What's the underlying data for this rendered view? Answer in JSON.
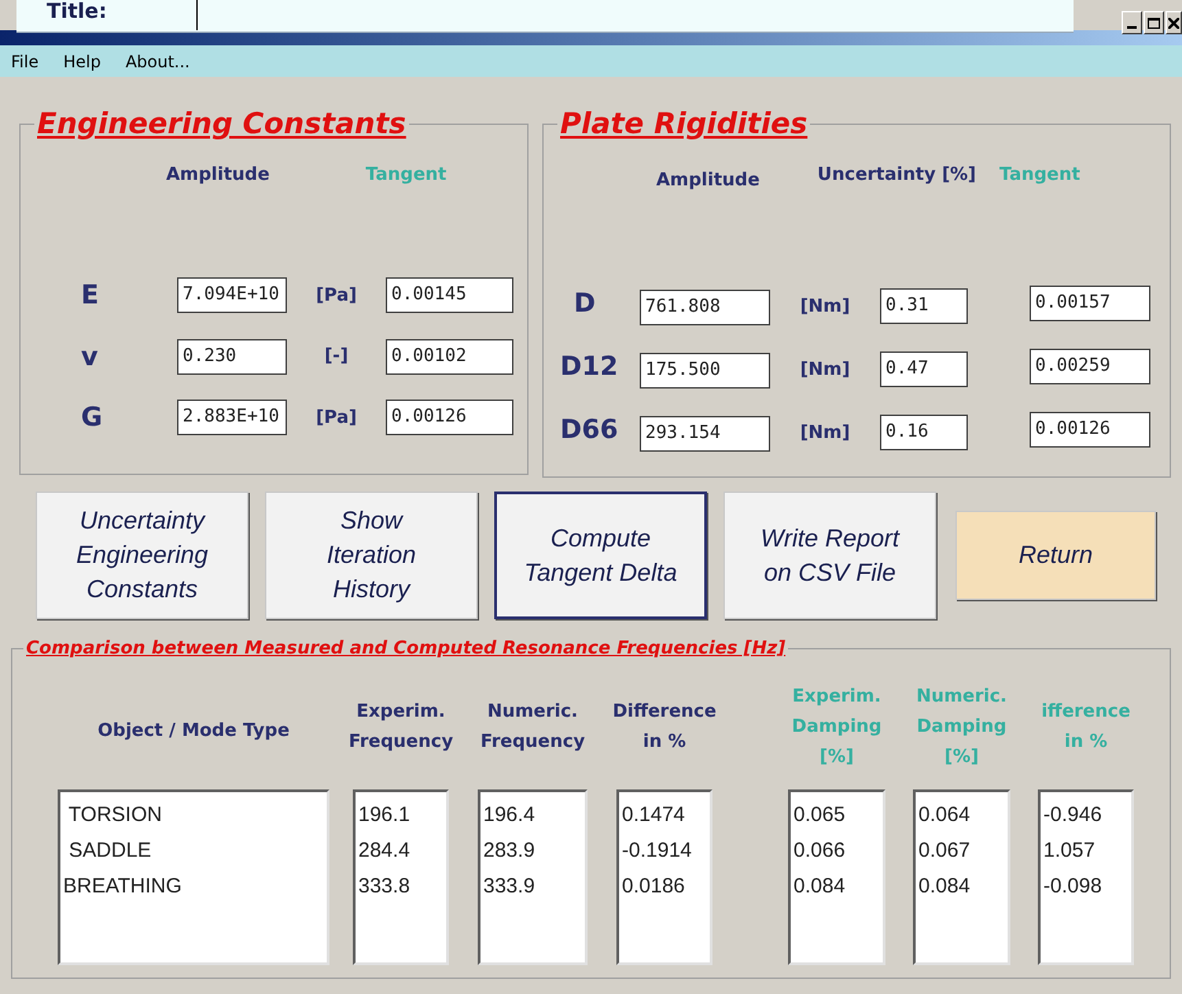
{
  "title_field": {
    "label": "Title:"
  },
  "menu": [
    "File",
    "Help",
    "About..."
  ],
  "engineering_constants": {
    "title": "Engineering Constants",
    "headers": [
      {
        "label": "Amplitude",
        "kind": "amplitude"
      },
      {
        "label": "Tangent",
        "kind": "tangent"
      }
    ],
    "rows": [
      {
        "symbol": "E",
        "amplitude": "7.094E+10",
        "unit": "[Pa]",
        "tangent": "0.00145"
      },
      {
        "symbol": "v",
        "amplitude": "0.230",
        "unit": "[-]",
        "tangent": "0.00102"
      },
      {
        "symbol": "G",
        "amplitude": "2.883E+10",
        "unit": "[Pa]",
        "tangent": "0.00126"
      }
    ]
  },
  "plate_rigidities": {
    "title": "Plate Rigidities",
    "headers": [
      {
        "label": "Amplitude",
        "kind": "amplitude"
      },
      {
        "label": "Uncertainty [%]",
        "kind": "amplitude"
      },
      {
        "label": "Tangent",
        "kind": "tangent"
      }
    ],
    "rows": [
      {
        "symbol": "D",
        "amplitude": "761.808",
        "unit": "[Nm]",
        "uncertainty": "0.31",
        "tangent": "0.00157"
      },
      {
        "symbol": "D12",
        "amplitude": "175.500",
        "unit": "[Nm]",
        "uncertainty": "0.47",
        "tangent": "0.00259"
      },
      {
        "symbol": "D66",
        "amplitude": "293.154",
        "unit": "[Nm]",
        "uncertainty": "0.16",
        "tangent": "0.00126"
      }
    ]
  },
  "buttons": [
    {
      "label": "Uncertainty\nEngineering\nConstants",
      "kind": "standard",
      "focused": false
    },
    {
      "label": "Show\nIteration\nHistory",
      "kind": "standard",
      "focused": false
    },
    {
      "label": "Compute\nTangent Delta",
      "kind": "standard",
      "focused": true
    },
    {
      "label": "Write Report\non CSV File",
      "kind": "standard",
      "focused": false
    },
    {
      "label": "Return",
      "kind": "return",
      "focused": false
    }
  ],
  "comparison": {
    "title": "Comparison between Measured and Computed Resonance Frequencies [Hz]",
    "columns": [
      {
        "label": "Object / Mode Type",
        "kind": "frequency",
        "values": [
          " TORSION",
          " SADDLE",
          "BREATHING"
        ]
      },
      {
        "label": "Experim.\nFrequency",
        "kind": "frequency",
        "values": [
          "196.1",
          "284.4",
          "333.8"
        ]
      },
      {
        "label": "Numeric.\nFrequency",
        "kind": "frequency",
        "values": [
          "196.4",
          "283.9",
          "333.9"
        ]
      },
      {
        "label": "Difference\nin %",
        "kind": "frequency",
        "values": [
          "0.1474",
          "-0.1914",
          "0.0186"
        ]
      },
      {
        "label": "Experim.\nDamping\n[%]",
        "kind": "damping",
        "values": [
          "0.065",
          "0.066",
          "0.084"
        ]
      },
      {
        "label": "Numeric.\nDamping\n[%]",
        "kind": "damping",
        "values": [
          "0.064",
          "0.067",
          "0.084"
        ]
      },
      {
        "label": "ifference\nin %",
        "kind": "damping",
        "values": [
          "-0.946",
          "1.057",
          "-0.098"
        ]
      }
    ]
  }
}
